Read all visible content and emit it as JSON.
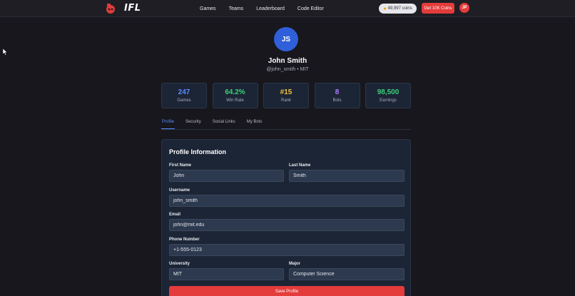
{
  "nav": {
    "logo_text": "IFL",
    "links": [
      "Games",
      "Teams",
      "Leaderboard",
      "Code Editor"
    ],
    "coins": "49,997 coins",
    "get_coins_label": "Get 10K Coins",
    "avatar_initials": "JP"
  },
  "profile": {
    "initials": "JS",
    "name": "John Smith",
    "subtitle": "@john_smith • MIT"
  },
  "stats": [
    {
      "value": "247",
      "label": "Games",
      "color": "#5b8cff"
    },
    {
      "value": "64.2%",
      "label": "Win Rate",
      "color": "#3ccf7a"
    },
    {
      "value": "#15",
      "label": "Rank",
      "color": "#f2c33a"
    },
    {
      "value": "8",
      "label": "Bots",
      "color": "#b07cff"
    },
    {
      "value": "98,500",
      "label": "Earnings",
      "color": "#3ccf7a"
    }
  ],
  "tabs": [
    "Profile",
    "Security",
    "Social Links",
    "My Bots"
  ],
  "form": {
    "title": "Profile Information",
    "first_name": {
      "label": "First Name",
      "value": "John"
    },
    "last_name": {
      "label": "Last Name",
      "value": "Smith"
    },
    "username": {
      "label": "Username",
      "value": "john_smith"
    },
    "email": {
      "label": "Email",
      "value": "john@mit.edu"
    },
    "phone": {
      "label": "Phone Number",
      "value": "+1-555-0123"
    },
    "university": {
      "label": "University",
      "value": "MIT"
    },
    "major": {
      "label": "Major",
      "value": "Computer Science"
    },
    "save_label": "Save Profile"
  },
  "colors": {
    "accent_red": "#e43b3b",
    "accent_blue": "#5b8cff",
    "avatar_blue": "#2f5fd9"
  }
}
